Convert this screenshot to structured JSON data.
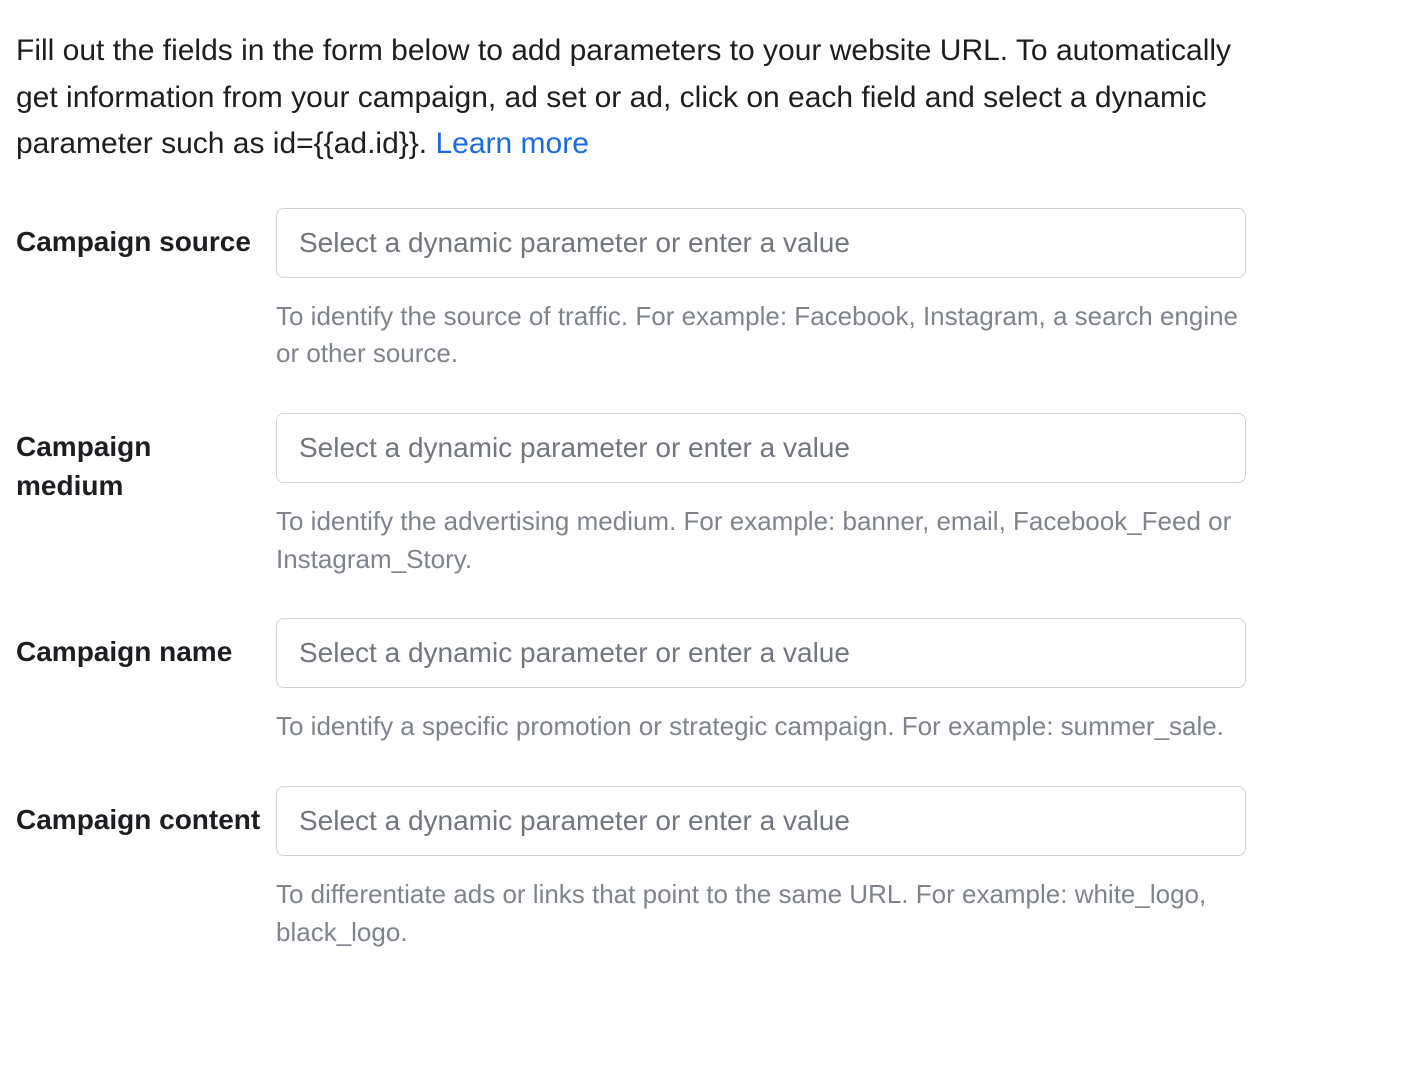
{
  "intro": {
    "text": "Fill out the fields in the form below to add parameters to your website URL. To automatically get information from your campaign, ad set or ad, click on each field and select a dynamic parameter such as id={{ad.id}}. ",
    "learn_more": "Learn more"
  },
  "fields": {
    "source": {
      "label": "Campaign source",
      "placeholder": "Select a dynamic parameter or enter a value",
      "help": "To identify the source of traffic. For example: Facebook, Instagram, a search engine or other source."
    },
    "medium": {
      "label": "Campaign medium",
      "placeholder": "Select a dynamic parameter or enter a value",
      "help": "To identify the advertising medium. For example: banner, email, Facebook_Feed or Instagram_Story."
    },
    "name": {
      "label": "Campaign name",
      "placeholder": "Select a dynamic parameter or enter a value",
      "help": "To identify a specific promotion or strategic campaign. For example: summer_sale."
    },
    "content": {
      "label": "Campaign content",
      "placeholder": "Select a dynamic parameter or enter a value",
      "help": "To differentiate ads or links that point to the same URL. For example: white_logo, black_logo."
    }
  }
}
